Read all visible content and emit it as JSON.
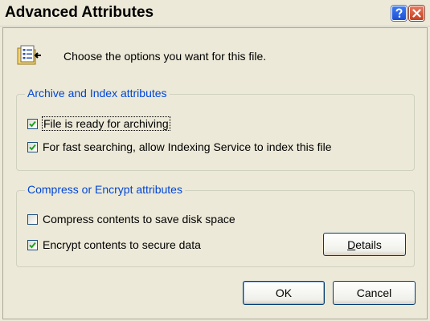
{
  "window": {
    "title": "Advanced Attributes",
    "help_glyph": "?",
    "close_glyph": "×"
  },
  "intro": {
    "icon": "folder-properties-icon",
    "text": "Choose the options you want for this file."
  },
  "archive_group": {
    "legend": "Archive and Index attributes",
    "items": [
      {
        "label": "File is ready for archiving",
        "checked": true
      },
      {
        "label": "For fast searching, allow Indexing Service to index this file",
        "checked": true
      }
    ]
  },
  "compress_group": {
    "legend": "Compress or Encrypt attributes",
    "items": [
      {
        "label": "Compress contents to save disk space",
        "checked": false
      },
      {
        "label": "Encrypt contents to secure data",
        "checked": true
      }
    ],
    "details_label": "Details"
  },
  "buttons": {
    "ok": "OK",
    "cancel": "Cancel"
  },
  "colors": {
    "dialog_bg": "#ece9d8",
    "legend_text": "#0046d5",
    "check_mark": "#21a121",
    "button_border": "#003c74"
  }
}
